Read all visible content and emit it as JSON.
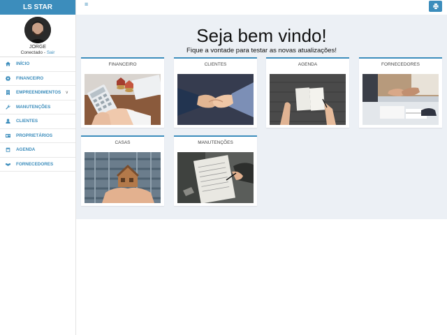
{
  "app": {
    "brand": "LS STAR"
  },
  "user": {
    "name": "JORGE",
    "status": "Conectado",
    "separator": " - ",
    "logout": "Sair"
  },
  "menu": [
    {
      "label": "INÍCIO",
      "icon": "home-icon"
    },
    {
      "label": "FINANCEIRO",
      "icon": "gear-icon"
    },
    {
      "label": "EMPREENDIMENTOS",
      "icon": "building-icon",
      "caret": "v"
    },
    {
      "label": "MANUTENÇÕES",
      "icon": "wrench-icon"
    },
    {
      "label": "CLIENTES",
      "icon": "user-icon"
    },
    {
      "label": "PROPRIETÁRIOS",
      "icon": "id-card-icon"
    },
    {
      "label": "AGENDA",
      "icon": "calendar-icon"
    },
    {
      "label": "FORNECEDORES",
      "icon": "handshake-icon"
    }
  ],
  "topbar": {
    "menu_toggle": "≡",
    "print_icon": "print-icon"
  },
  "welcome": {
    "title": "Seja bem vindo!",
    "subtitle": "Fique a vontade para testar as novas atualizações!"
  },
  "cards": [
    {
      "title": "FINANCEIRO",
      "image": "calculator-coins-photo"
    },
    {
      "title": "CLIENTES",
      "image": "handshake-photo"
    },
    {
      "title": "AGENDA",
      "image": "notebook-photo"
    },
    {
      "title": "FORNECEDORES",
      "image": "business-meeting-photo"
    },
    {
      "title": "CASAS",
      "image": "house-in-hands-photo"
    },
    {
      "title": "MANUTENÇÕES",
      "image": "clipboard-writing-photo"
    }
  ],
  "colors": {
    "accent": "#3c8dbc",
    "content_bg": "#ecf0f5"
  }
}
